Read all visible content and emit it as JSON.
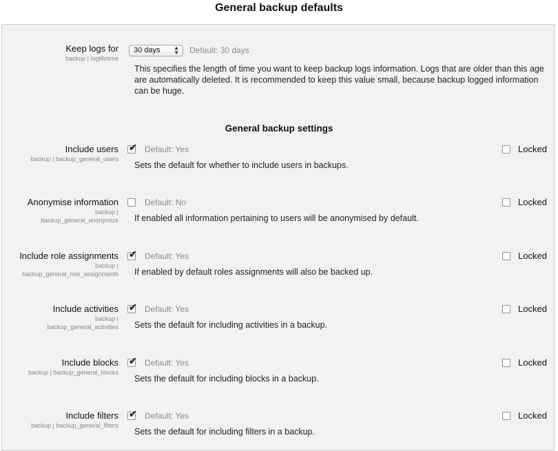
{
  "title": "General backup defaults",
  "loglifetime": {
    "label": "Keep logs for",
    "key": "backup | loglifetime",
    "select_value": "30 days",
    "default": "Default: 30 days",
    "description": "This specifies the length of time you want to keep backup logs information. Logs that are older than this age are automatically deleted. It is recommended to keep this value small, because backup logged information can be huge."
  },
  "section_heading": "General backup settings",
  "locked_label": "Locked",
  "settings": [
    {
      "label": "Include users",
      "key_lines": [
        "backup | backup_general_users"
      ],
      "checked": true,
      "default": "Default: Yes",
      "description": "Sets the default for whether to include users in backups.",
      "locked": false
    },
    {
      "label": "Anonymise information",
      "key_lines": [
        "backup |",
        "backup_general_anonymize"
      ],
      "checked": false,
      "default": "Default: No",
      "description": "If enabled all information pertaining to users will be anonymised by default.",
      "locked": false
    },
    {
      "label": "Include role assignments",
      "key_lines": [
        "backup |",
        "backup_general_role_assignments"
      ],
      "checked": true,
      "default": "Default: Yes",
      "description": "If enabled by default roles assignments will also be backed up.",
      "locked": false
    },
    {
      "label": "Include activities",
      "key_lines": [
        "backup |",
        "backup_general_activities"
      ],
      "checked": true,
      "default": "Default: Yes",
      "description": "Sets the default for including activities in a backup.",
      "locked": false
    },
    {
      "label": "Include blocks",
      "key_lines": [
        "backup | backup_general_blocks"
      ],
      "checked": true,
      "default": "Default: Yes",
      "description": "Sets the default for including blocks in a backup.",
      "locked": false
    },
    {
      "label": "Include filters",
      "key_lines": [
        "backup | backup_general_filters"
      ],
      "checked": true,
      "default": "Default: Yes",
      "description": "Sets the default for including filters in a backup.",
      "locked": false
    }
  ]
}
